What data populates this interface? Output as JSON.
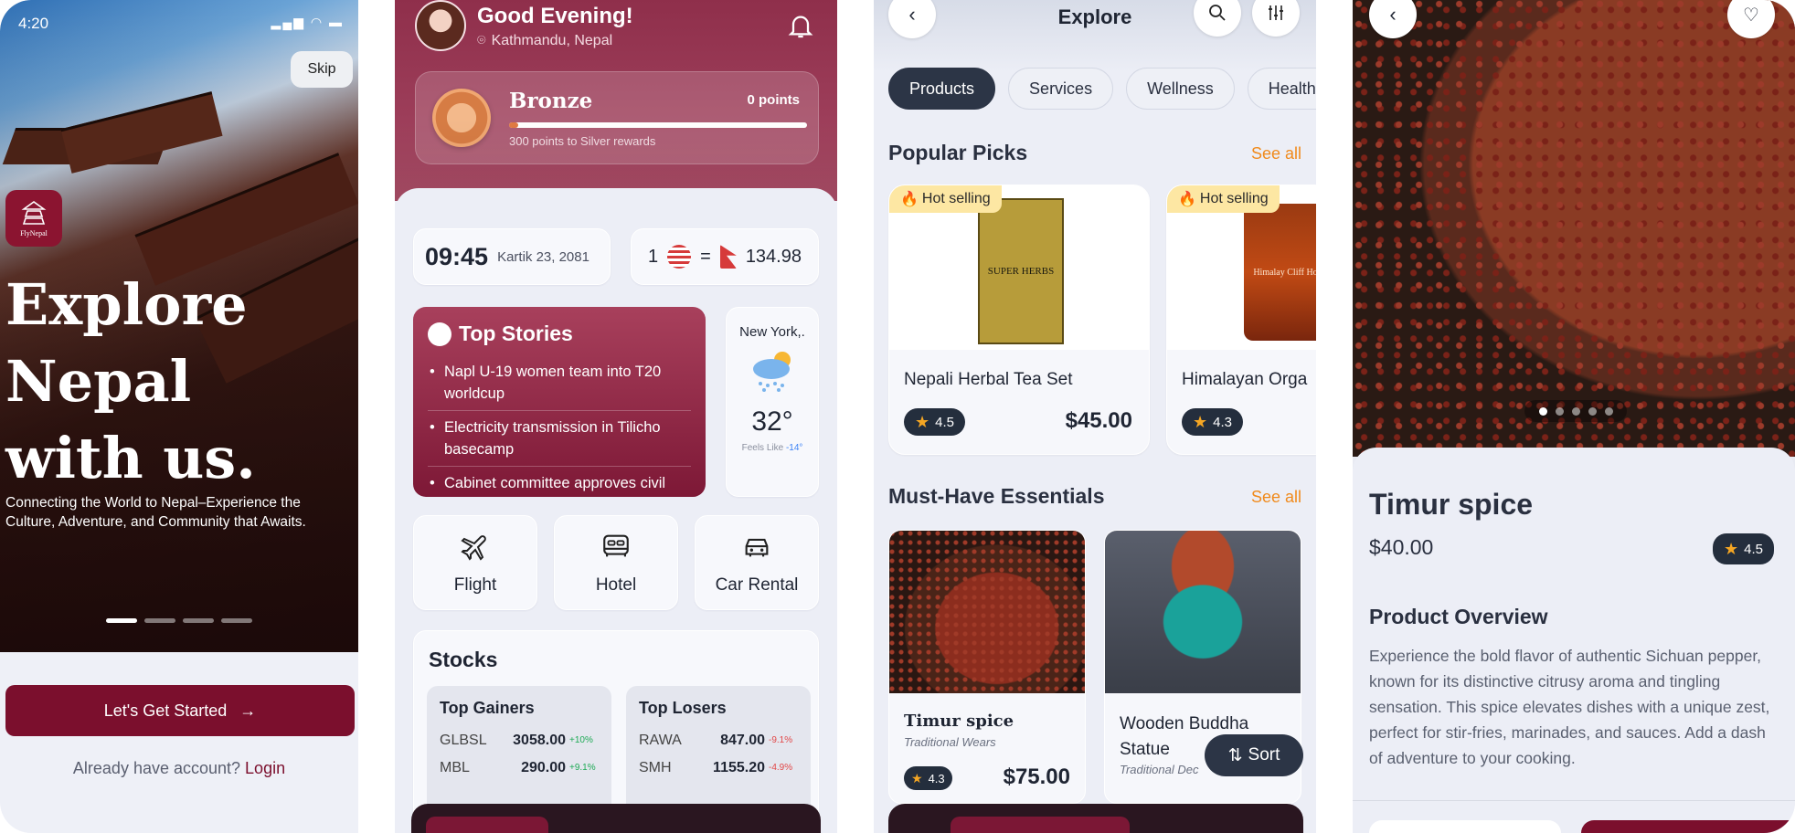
{
  "screen1": {
    "status_time": "4:20",
    "skip_label": "Skip",
    "logo_text": "FlyNepal",
    "headline": "Explore\nNepal\nwith us.",
    "subtext": "Connecting the World to Nepal–Experience the Culture, Adventure, and Community that Awaits.",
    "cta_label": "Let's Get Started",
    "login_prompt": "Already have account?",
    "login_link": "Login",
    "carousel_pages": 4,
    "carousel_active": 1
  },
  "screen2": {
    "greeting": "Good Evening!",
    "location": "Kathmandu, Nepal",
    "tier": {
      "name": "Bronze",
      "points": "0 points",
      "progress_note": "300 points to Silver rewards",
      "progress_percent": 0
    },
    "time": "09:45",
    "date": "Kartik 23, 2081",
    "fx_amount": "1",
    "fx_equals": "=",
    "fx_rate": "134.98",
    "top_stories": {
      "title": "Top Stories",
      "items": [
        "Napl U-19 women team into T20 worldcup",
        "Electricity transmission in Tilicho basecamp",
        "Cabinet committee approves civil"
      ]
    },
    "weather": {
      "city": "New York,.",
      "temp": "32°",
      "feels_label": "Feels Like",
      "feels_value": "-14°"
    },
    "services": [
      {
        "label": "Flight",
        "icon": "plane-icon"
      },
      {
        "label": "Hotel",
        "icon": "bed-icon"
      },
      {
        "label": "Car Rental",
        "icon": "car-icon"
      }
    ],
    "stocks": {
      "title": "Stocks",
      "gainers_title": "Top Gainers",
      "gainers": [
        {
          "ticker": "GLBSL",
          "value": "3058.00",
          "change": "+10%"
        },
        {
          "ticker": "MBL",
          "value": "290.00",
          "change": "+9.1%"
        }
      ],
      "losers_title": "Top Losers",
      "losers": [
        {
          "ticker": "RAWA",
          "value": "847.00",
          "change": "-9.1%"
        },
        {
          "ticker": "SMH",
          "value": "1155.20",
          "change": "-4.9%"
        }
      ]
    }
  },
  "screen3": {
    "title": "Explore",
    "chips": [
      "Products",
      "Services",
      "Wellness",
      "Health"
    ],
    "active_chip": "Products",
    "popular_title": "Popular Picks",
    "see_all": "See all",
    "popular": [
      {
        "badge": "Hot selling",
        "name": "Nepali Herbal Tea Set",
        "rating": "4.5",
        "price": "$45.00",
        "product_label": "SUPER HERBS"
      },
      {
        "badge": "Hot selling",
        "name": "Himalayan Orga",
        "rating": "4.3",
        "price": "",
        "product_label": "Himalay Cliff Hon"
      }
    ],
    "essentials_title": "Must-Have Essentials",
    "essentials": [
      {
        "name": "Timur spice",
        "sub": "Traditional Wears",
        "rating": "4.3",
        "price": "$75.00"
      },
      {
        "name": "Wooden Buddha Statue",
        "sub": "Traditional Dec",
        "rating": "",
        "price": ""
      }
    ],
    "sort_label": "Sort"
  },
  "screen4": {
    "name": "Timur spice",
    "price": "$40.00",
    "rating": "4.5",
    "overview_title": "Product Overview",
    "description": "Experience the bold flavor of authentic Sichuan pepper, known for its distinctive citrusy aroma and tingling sensation. This spice elevates dishes with a unique zest, perfect for stir-fries, marinades, and sauces. Add a dash of adventure to your cooking.",
    "image_pages": 5,
    "image_active": 1
  },
  "colors": {
    "brand": "#7b0f2d",
    "accent": "#f08a1c",
    "dark": "#2c3546",
    "bg": "#eceef6"
  }
}
